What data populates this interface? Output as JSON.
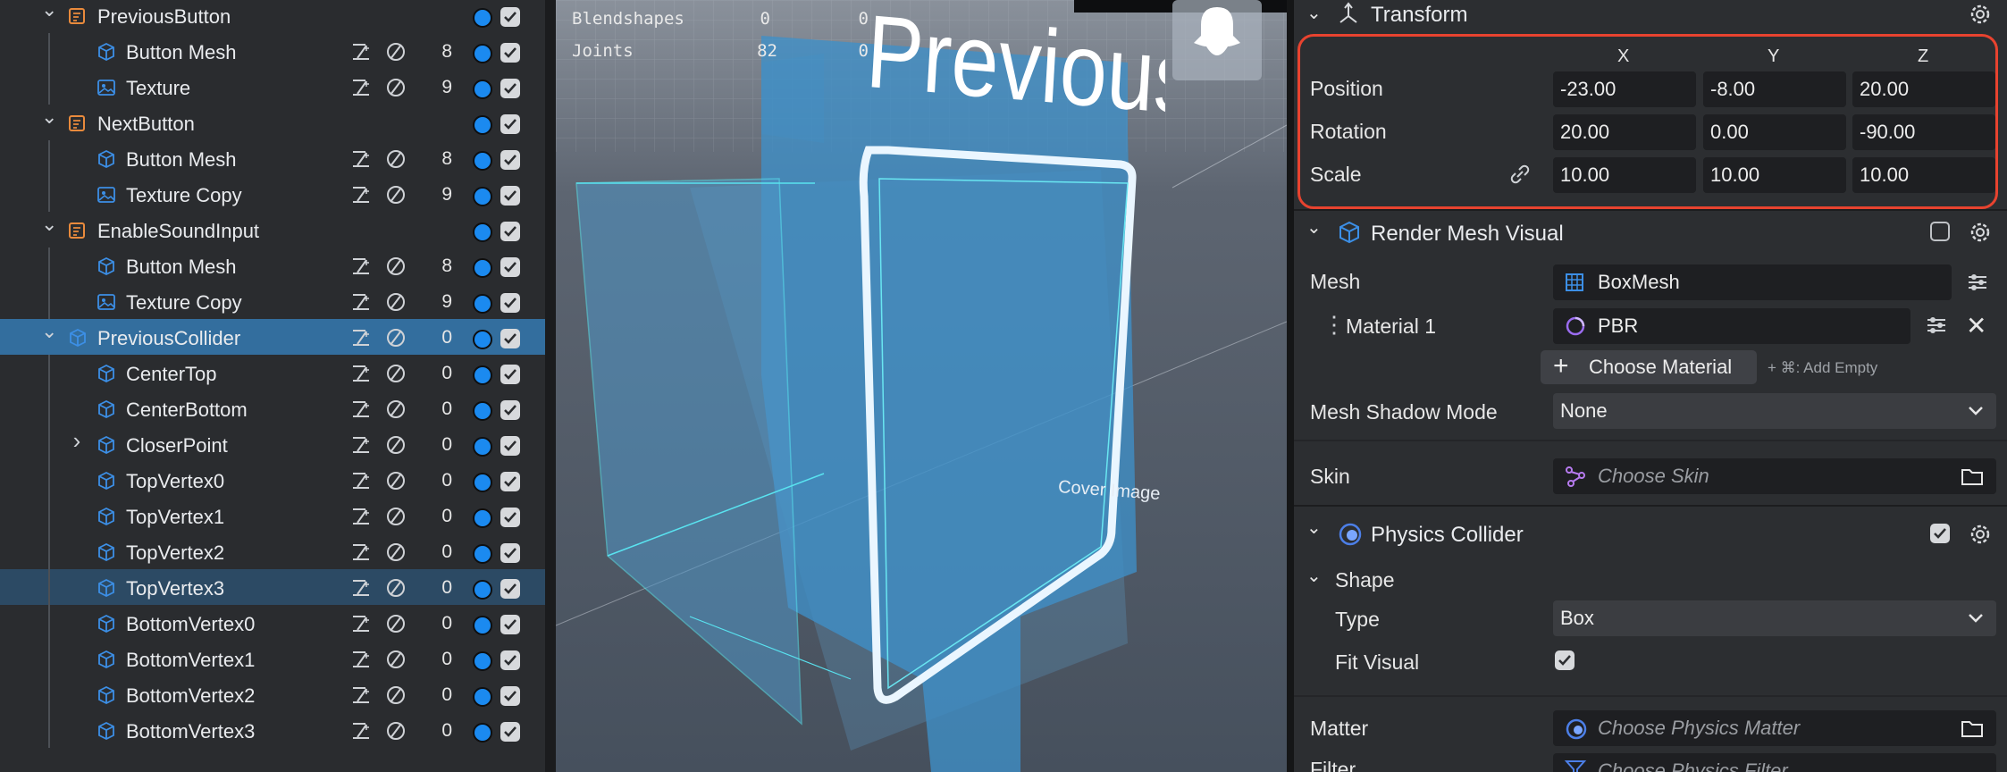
{
  "hierarchy": {
    "rows": [
      {
        "label": "PreviousButton",
        "kind": "group",
        "chevron": "down",
        "count": "",
        "depth": 0
      },
      {
        "label": "Button Mesh",
        "kind": "mesh",
        "chevron": "",
        "count": "8",
        "depth": 1
      },
      {
        "label": "Texture",
        "kind": "image",
        "chevron": "",
        "count": "9",
        "depth": 1
      },
      {
        "label": "NextButton",
        "kind": "group",
        "chevron": "down",
        "count": "",
        "depth": 0
      },
      {
        "label": "Button Mesh",
        "kind": "mesh",
        "chevron": "",
        "count": "8",
        "depth": 1
      },
      {
        "label": "Texture Copy",
        "kind": "image",
        "chevron": "",
        "count": "9",
        "depth": 1
      },
      {
        "label": "EnableSoundInput",
        "kind": "group",
        "chevron": "down",
        "count": "",
        "depth": 0
      },
      {
        "label": "Button Mesh",
        "kind": "mesh",
        "chevron": "",
        "count": "8",
        "depth": 1
      },
      {
        "label": "Texture Copy",
        "kind": "image",
        "chevron": "",
        "count": "9",
        "depth": 1
      },
      {
        "label": "PreviousCollider",
        "kind": "mesh",
        "chevron": "down",
        "count": "0",
        "depth": 0,
        "state": "selected"
      },
      {
        "label": "CenterTop",
        "kind": "mesh",
        "chevron": "",
        "count": "0",
        "depth": 1
      },
      {
        "label": "CenterBottom",
        "kind": "mesh",
        "chevron": "",
        "count": "0",
        "depth": 1
      },
      {
        "label": "CloserPoint",
        "kind": "mesh",
        "chevron": "right",
        "count": "0",
        "depth": 1
      },
      {
        "label": "TopVertex0",
        "kind": "mesh",
        "chevron": "",
        "count": "0",
        "depth": 1
      },
      {
        "label": "TopVertex1",
        "kind": "mesh",
        "chevron": "",
        "count": "0",
        "depth": 1
      },
      {
        "label": "TopVertex2",
        "kind": "mesh",
        "chevron": "",
        "count": "0",
        "depth": 1
      },
      {
        "label": "TopVertex3",
        "kind": "mesh",
        "chevron": "",
        "count": "0",
        "depth": 1,
        "state": "hover"
      },
      {
        "label": "BottomVertex0",
        "kind": "mesh",
        "chevron": "",
        "count": "0",
        "depth": 1
      },
      {
        "label": "BottomVertex1",
        "kind": "mesh",
        "chevron": "",
        "count": "0",
        "depth": 1
      },
      {
        "label": "BottomVertex2",
        "kind": "mesh",
        "chevron": "",
        "count": "0",
        "depth": 1
      },
      {
        "label": "BottomVertex3",
        "kind": "mesh",
        "chevron": "",
        "count": "0",
        "depth": 1
      }
    ]
  },
  "viewport": {
    "stats": [
      {
        "label": "Blendshapes",
        "a": "0",
        "b": "0"
      },
      {
        "label": "Joints",
        "a": "82",
        "b": "0"
      }
    ],
    "scene_text": "Previous",
    "cover_label": "Cover Image"
  },
  "inspector": {
    "transform": {
      "title": "Transform",
      "axes": [
        "X",
        "Y",
        "Z"
      ],
      "rows": [
        {
          "label": "Position",
          "values": [
            "-23.00",
            "-8.00",
            "20.00"
          ]
        },
        {
          "label": "Rotation",
          "values": [
            "20.00",
            "0.00",
            "-90.00"
          ]
        },
        {
          "label": "Scale",
          "values": [
            "10.00",
            "10.00",
            "10.00"
          ]
        }
      ]
    },
    "render_mesh": {
      "title": "Render Mesh Visual",
      "mesh_label": "Mesh",
      "mesh_value": "BoxMesh",
      "material_label": "Material 1",
      "material_value": "PBR",
      "choose_material": "Choose Material",
      "add_empty_hint": "+ ⌘: Add Empty",
      "shadow_label": "Mesh Shadow Mode",
      "shadow_value": "None",
      "skin_label": "Skin",
      "skin_placeholder": "Choose Skin"
    },
    "physics": {
      "title": "Physics Collider",
      "shape_label": "Shape",
      "type_label": "Type",
      "type_value": "Box",
      "fit_label": "Fit Visual",
      "matter_label": "Matter",
      "matter_placeholder": "Choose Physics Matter",
      "filter_label": "Filter",
      "filter_placeholder": "Choose Physics Filter"
    }
  },
  "colors": {
    "selection": "#336e9e",
    "hover": "#2c4a64",
    "accent_blue": "#1b8af0",
    "group_icon": "#e98a3c",
    "highlight_border": "#e8432f"
  }
}
